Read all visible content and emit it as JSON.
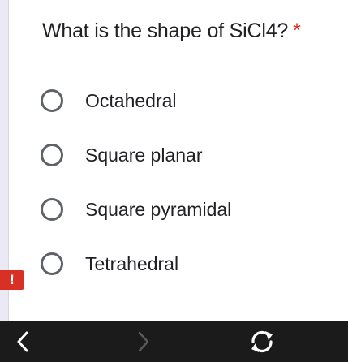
{
  "question": {
    "text": "What is the shape of SiCl4?",
    "required_marker": "*"
  },
  "options": [
    {
      "label": "Octahedral",
      "selected": false
    },
    {
      "label": "Square planar",
      "selected": false
    },
    {
      "label": "Square pyramidal",
      "selected": false
    },
    {
      "label": "Tetrahedral",
      "selected": false
    }
  ],
  "error_badge": {
    "symbol": "!",
    "color": "#d93025"
  },
  "navbar": {
    "back_icon": "chevron-left-icon",
    "forward_icon": "chevron-right-icon",
    "reload_icon": "reload-icon",
    "forward_enabled": false
  },
  "colors": {
    "required": "#d93025",
    "text": "#202124",
    "radio_border": "#5f6368",
    "navbar_bg": "#1b1b1b"
  }
}
